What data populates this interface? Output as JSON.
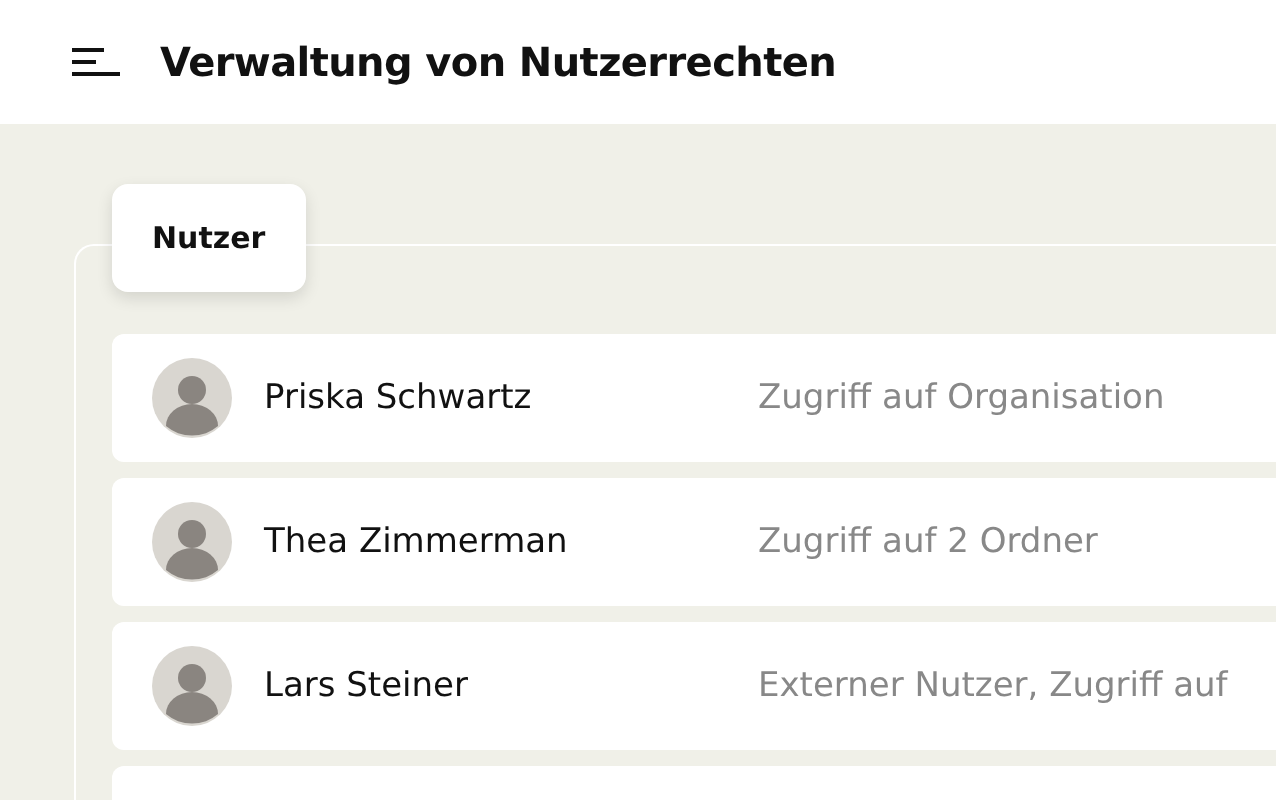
{
  "header": {
    "title": "Verwaltung von Nutzerrechten"
  },
  "tabs": [
    {
      "label": "Nutzer",
      "selected": true
    }
  ],
  "users": [
    {
      "name": "Priska Schwartz",
      "access": "Zugriff auf Organisation"
    },
    {
      "name": "Thea Zimmerman",
      "access": "Zugriff auf 2 Ordner"
    },
    {
      "name": "Lars Steiner",
      "access": "Externer Nutzer, Zugriff auf"
    }
  ]
}
